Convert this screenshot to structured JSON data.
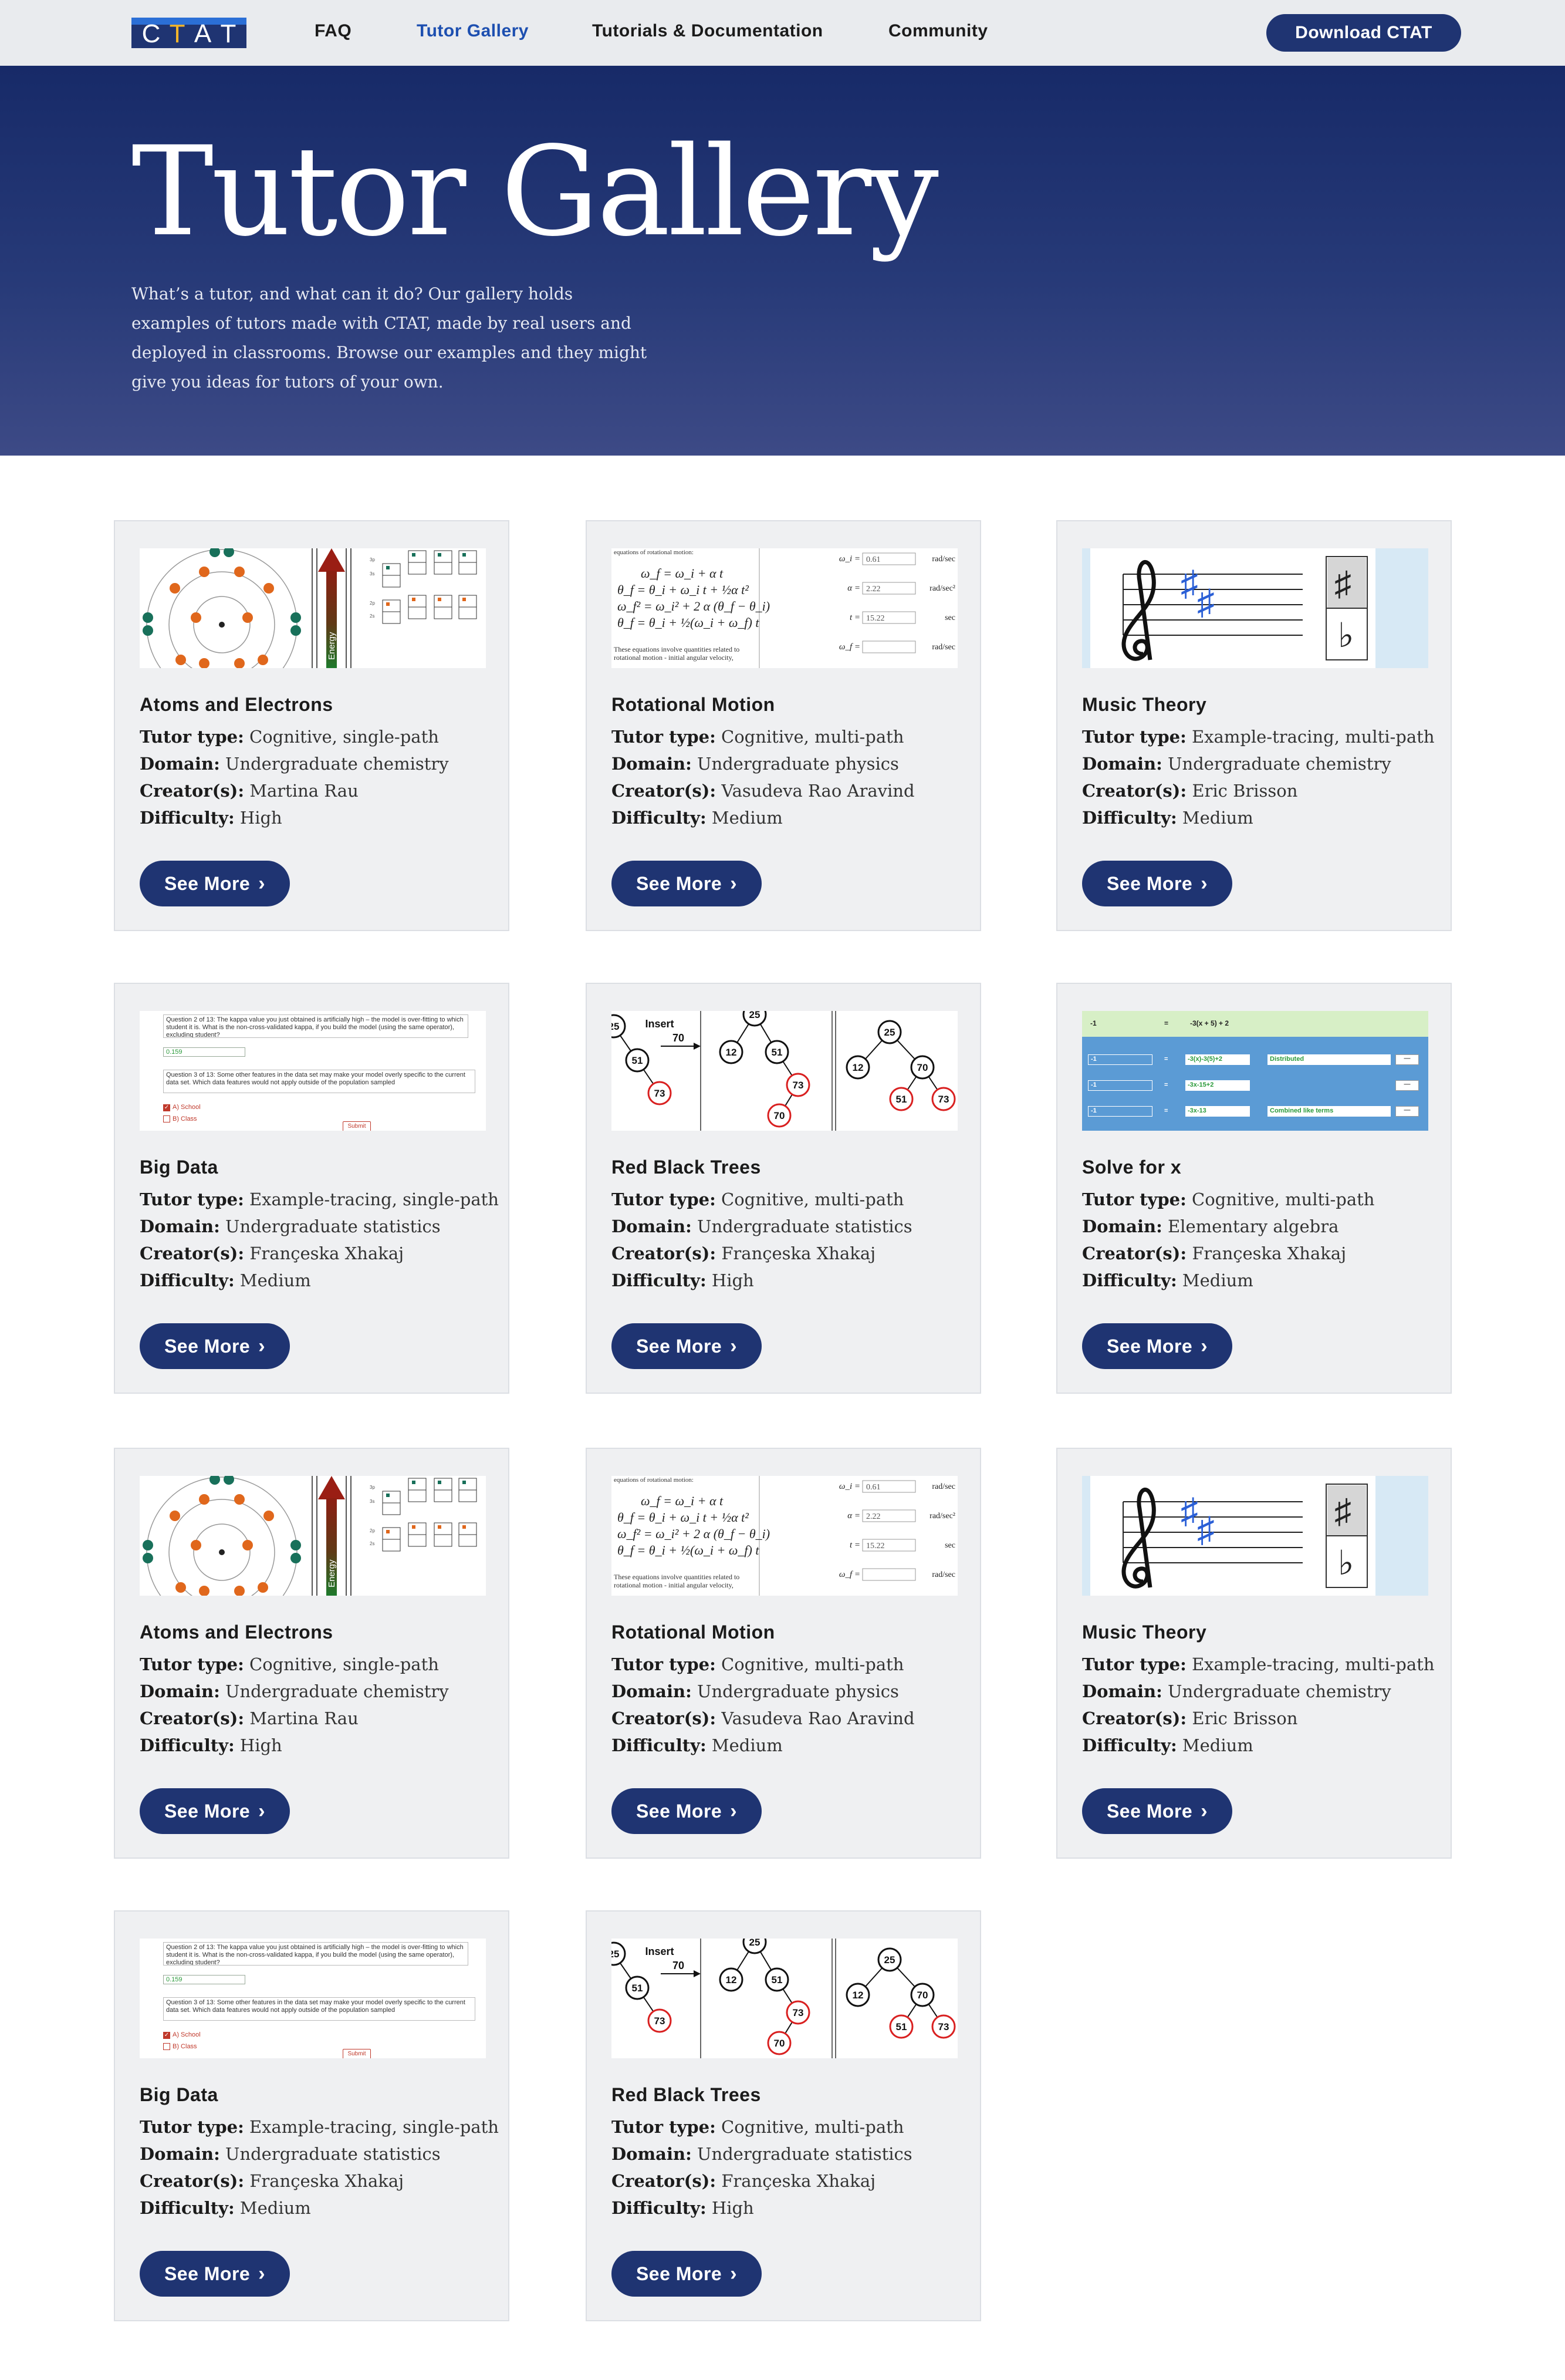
{
  "nav": {
    "logo_letters": [
      "C",
      "T",
      "A",
      "T"
    ],
    "links": [
      "FAQ",
      "Tutor Gallery",
      "Tutorials & Documentation",
      "Community"
    ],
    "active": "Tutor Gallery",
    "download_label": "Download CTAT"
  },
  "hero": {
    "title": "Tutor Gallery",
    "description": "What’s a tutor, and what can it do? Our gallery holds examples of tutors made with CTAT, made by real users and deployed in classrooms. Browse our examples and they might give you ideas for tutors of your own."
  },
  "labels": {
    "tutor_type": "Tutor type:",
    "domain": "Domain:",
    "creators": "Creator(s):",
    "difficulty": "Difficulty:",
    "see_more": "See More"
  },
  "cards": [
    {
      "title": "Atoms and Electrons",
      "thumb": "atoms",
      "tutor_type": "Cognitive, single-path",
      "domain": "Undergraduate chemistry",
      "creators": "Martina Rau",
      "difficulty": "High"
    },
    {
      "title": "Rotational Motion",
      "thumb": "rotational",
      "tutor_type": "Cognitive, multi-path",
      "domain": "Undergraduate physics",
      "creators": "Vasudeva Rao Aravind",
      "difficulty": "Medium"
    },
    {
      "title": "Music Theory",
      "thumb": "music",
      "tutor_type": "Example-tracing, multi-path",
      "domain": "Undergraduate chemistry",
      "creators": "Eric Brisson",
      "difficulty": "Medium"
    },
    {
      "title": "Big Data",
      "thumb": "bigdata",
      "tutor_type": "Example-tracing, single-path",
      "domain": "Undergraduate statistics",
      "creators": "Françeska Xhakaj",
      "difficulty": "Medium"
    },
    {
      "title": "Red Black Trees",
      "thumb": "rbtree",
      "tutor_type": "Cognitive, multi-path",
      "domain": "Undergraduate statistics",
      "creators": "Françeska Xhakaj",
      "difficulty": "High"
    },
    {
      "title": "Solve for x",
      "thumb": "solvex",
      "tutor_type": "Cognitive, multi-path",
      "domain": "Elementary algebra",
      "creators": "Françeska Xhakaj",
      "difficulty": "Medium"
    },
    {
      "title": "Atoms and Electrons",
      "thumb": "atoms",
      "tutor_type": "Cognitive, single-path",
      "domain": "Undergraduate chemistry",
      "creators": "Martina Rau",
      "difficulty": "High"
    },
    {
      "title": "Rotational Motion",
      "thumb": "rotational",
      "tutor_type": "Cognitive, multi-path",
      "domain": "Undergraduate physics",
      "creators": "Vasudeva Rao Aravind",
      "difficulty": "Medium"
    },
    {
      "title": "Music Theory",
      "thumb": "music",
      "tutor_type": "Example-tracing, multi-path",
      "domain": "Undergraduate chemistry",
      "creators": "Eric Brisson",
      "difficulty": "Medium"
    },
    {
      "title": "Big Data",
      "thumb": "bigdata",
      "tutor_type": "Example-tracing, single-path",
      "domain": "Undergraduate statistics",
      "creators": "Françeska Xhakaj",
      "difficulty": "Medium"
    },
    {
      "title": "Red Black Trees",
      "thumb": "rbtree",
      "tutor_type": "Cognitive, multi-path",
      "domain": "Undergraduate statistics",
      "creators": "Françeska Xhakaj",
      "difficulty": "High"
    }
  ],
  "thumbs": {
    "atoms": {
      "energy_label": "Energy"
    },
    "rotational": {
      "intro": "equations of rotational motion:",
      "eq1": "ω_f = ω_i + α t",
      "eq2": "θ_f = θ_i + ω_i t + ½α t²",
      "eq3": "ω_f² = ω_i² + 2 α (θ_f − θ_i)",
      "eq4": "θ_f = θ_i + ½(ω_i + ω_f) t",
      "foot1": "These equations involve quantities related to",
      "foot2": "rotational motion - initial angular velocity,",
      "fields": [
        {
          "label": "ω_i =",
          "value": "0.61",
          "unit": "rad/sec"
        },
        {
          "label": "α =",
          "value": "2.22",
          "unit": "rad/sec²"
        },
        {
          "label": "t =",
          "value": "15.22",
          "unit": "sec"
        },
        {
          "label": "ω_f =",
          "value": "",
          "unit": "rad/sec"
        }
      ]
    },
    "music": {
      "sharp": "♯",
      "flat": "♭"
    },
    "bigdata": {
      "q2": "Question 2 of 13: The kappa value you just obtained is artificially high – the model is over-fitting to which student it is. What is the non-cross-validated kappa, if you build the model (using the same operator), excluding student?",
      "answer": "0.159",
      "q3": "Question 3 of 13: Some other features in the data set may make your model overly specific to the current data set. Which data features would not apply outside of the population sampled",
      "opt_a": "A) School",
      "opt_b": "B) Class",
      "submit": "Submit"
    },
    "rbtree": {
      "insert_label": "Insert",
      "insert_value": "70",
      "nodes": [
        "25",
        "51",
        "73",
        "25",
        "12",
        "51",
        "73",
        "70",
        "25",
        "12",
        "70",
        "51",
        "73"
      ]
    },
    "solvex": {
      "header_left": "-1",
      "header_eq": "=",
      "header_right": "-3(x + 5) + 2",
      "rows": [
        {
          "left": "-1",
          "eq": "=",
          "right": "-3(x)-3(5)+2",
          "step": "Distributed"
        },
        {
          "left": "-1",
          "eq": "=",
          "right": "-3x-15+2",
          "step": ""
        },
        {
          "left": "-1",
          "eq": "=",
          "right": "-3x-13",
          "step": "Combined like terms"
        }
      ]
    }
  }
}
